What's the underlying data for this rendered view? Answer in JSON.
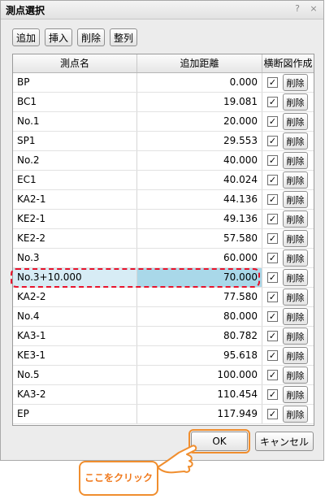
{
  "dialog": {
    "title": "測点選択",
    "help_glyph": "?",
    "close_glyph": "×"
  },
  "toolbar": {
    "add": "追加",
    "insert": "挿入",
    "delete": "削除",
    "arrange": "整列"
  },
  "table": {
    "headers": {
      "name": "測点名",
      "distance": "追加距離",
      "cross": "横断図作成"
    },
    "delete_label": "削除",
    "check_glyph": "✓",
    "rows": [
      {
        "name": "BP",
        "distance": "0.000",
        "checked": true
      },
      {
        "name": "BC1",
        "distance": "19.081",
        "checked": true
      },
      {
        "name": "No.1",
        "distance": "20.000",
        "checked": true
      },
      {
        "name": "SP1",
        "distance": "29.553",
        "checked": true
      },
      {
        "name": "No.2",
        "distance": "40.000",
        "checked": true
      },
      {
        "name": "EC1",
        "distance": "40.024",
        "checked": true
      },
      {
        "name": "KA2-1",
        "distance": "44.136",
        "checked": true
      },
      {
        "name": "KE2-1",
        "distance": "49.136",
        "checked": true
      },
      {
        "name": "KE2-2",
        "distance": "57.580",
        "checked": true
      },
      {
        "name": "No.3",
        "distance": "60.000",
        "checked": true
      },
      {
        "name": "No.3+10.000",
        "distance": "70.000",
        "checked": true,
        "selected": true
      },
      {
        "name": "KA2-2",
        "distance": "77.580",
        "checked": true
      },
      {
        "name": "No.4",
        "distance": "80.000",
        "checked": true
      },
      {
        "name": "KA3-1",
        "distance": "80.782",
        "checked": true
      },
      {
        "name": "KE3-1",
        "distance": "95.618",
        "checked": true
      },
      {
        "name": "No.5",
        "distance": "100.000",
        "checked": true
      },
      {
        "name": "KA3-2",
        "distance": "110.454",
        "checked": true
      },
      {
        "name": "EP",
        "distance": "117.949",
        "checked": true
      }
    ]
  },
  "footer": {
    "ok": "OK",
    "cancel": "キャンセル"
  },
  "annotation": {
    "callout": "ここをクリック",
    "color": "#f08e2e",
    "highlight_color": "#e8132c"
  }
}
